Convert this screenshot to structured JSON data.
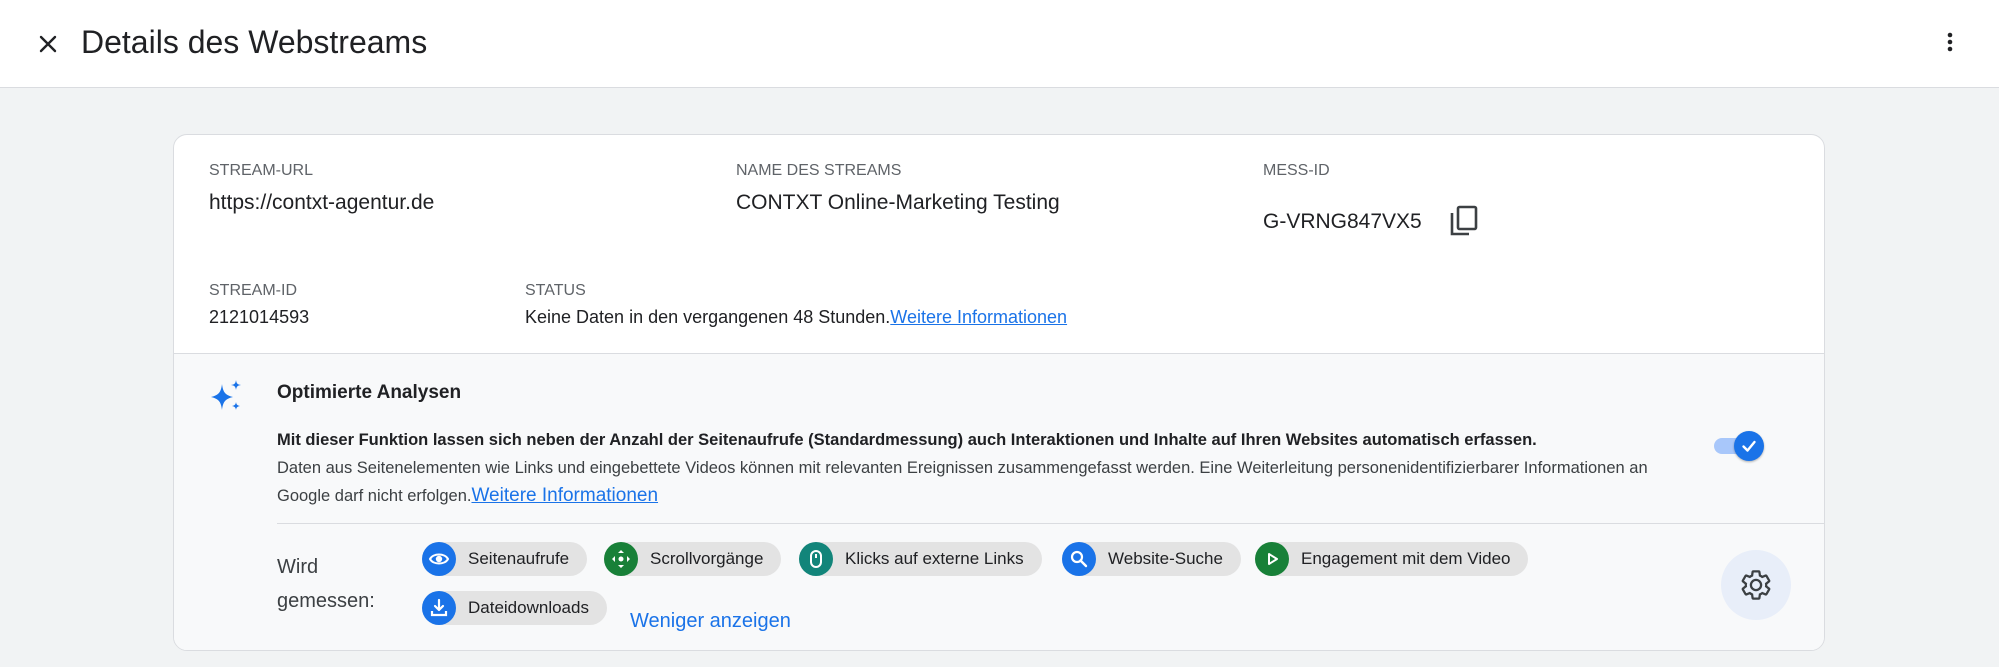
{
  "header": {
    "title": "Details des Webstreams",
    "close_icon": "close-icon",
    "more_icon": "more-vert-icon"
  },
  "stream": {
    "url_label": "STREAM-URL",
    "url_value": "https://contxt-agentur.de",
    "name_label": "NAME DES STREAMS",
    "name_value": "CONTXT Online-Marketing Testing",
    "mess_label": "MESS-ID",
    "mess_value": "G-VRNG847VX5",
    "id_label": "STREAM-ID",
    "id_value": "2121014593",
    "status_label": "STATUS",
    "status_value": "Keine Daten in den vergangenen 48 Stunden.",
    "status_link": "Weitere Informationen"
  },
  "enhanced": {
    "title": "Optimierte Analysen",
    "desc_bold": "Mit dieser Funktion lassen sich neben der Anzahl der Seitenaufrufe (Standardmessung) auch Interaktionen und Inhalte auf Ihren Websites automatisch erfassen.",
    "desc_text": "Daten aus Seitenelementen wie Links und eingebettete Videos können mit relevanten Ereignissen zusammengefasst werden. Eine Weiterleitung personenidentifizierbarer Informationen an Google darf nicht erfolgen.",
    "desc_link": "Weitere Informationen",
    "toggle_on": true,
    "measured_label": "Wird gemessen:",
    "chips": [
      {
        "label": "Seitenaufrufe",
        "icon": "eye-icon",
        "color": "#1a73e8"
      },
      {
        "label": "Scrollvorgänge",
        "icon": "scroll-arrows-icon",
        "color": "#188038"
      },
      {
        "label": "Klicks auf externe Links",
        "icon": "mouse-icon",
        "color": "#12857a"
      },
      {
        "label": "Website-Suche",
        "icon": "search-icon",
        "color": "#1a73e8"
      },
      {
        "label": "Engagement mit dem Video",
        "icon": "play-icon",
        "color": "#188038"
      },
      {
        "label": "Dateidownloads",
        "icon": "download-icon",
        "color": "#1a73e8"
      }
    ],
    "less_link": "Weniger anzeigen"
  },
  "colors": {
    "accent": "#1a73e8",
    "background": "#f1f3f4",
    "card": "#ffffff",
    "chip": "#e3e3e3"
  }
}
